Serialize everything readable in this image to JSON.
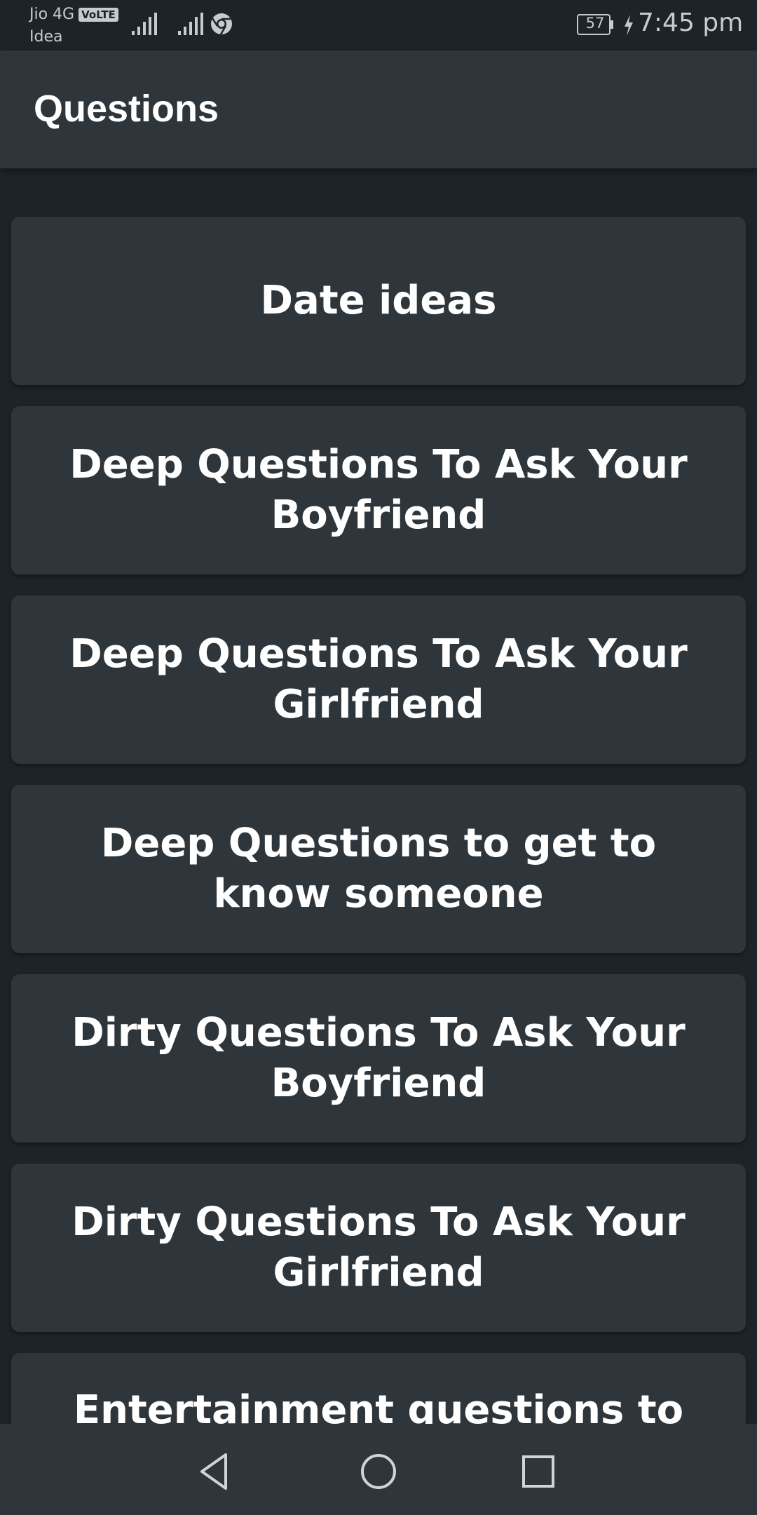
{
  "status_bar": {
    "carrier_primary": "Jio 4G",
    "volte_badge": "VoLTE",
    "carrier_secondary": "Idea",
    "battery": "57",
    "time": "7:45 pm",
    "icons": [
      "signal-icon",
      "signal-icon",
      "chrome-icon",
      "battery-icon",
      "charging-icon"
    ]
  },
  "app_bar": {
    "title": "Questions"
  },
  "list": {
    "items": [
      {
        "label": "Date ideas"
      },
      {
        "label": "Deep Questions To Ask Your Boyfriend"
      },
      {
        "label": "Deep Questions To Ask Your Girlfriend"
      },
      {
        "label": "Deep Questions to get to know someone"
      },
      {
        "label": "Dirty Questions To Ask Your Boyfriend"
      },
      {
        "label": "Dirty Questions To Ask Your Girlfriend"
      },
      {
        "label": "Entertainment questions to ask"
      }
    ]
  },
  "nav_bar": {
    "buttons": [
      "back-icon",
      "home-icon",
      "recents-icon"
    ]
  },
  "colors": {
    "background": "#1c2428",
    "surface": "#2e363b",
    "text": "#ffffff",
    "status_text": "#c7cbcd"
  }
}
